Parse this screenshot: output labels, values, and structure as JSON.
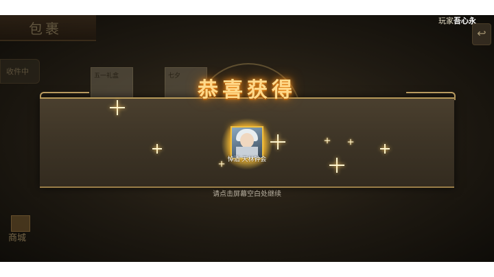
{
  "background": {
    "title": "包裹",
    "player_label": "玩家",
    "player_name": "吾心永",
    "side_tab": "收件中",
    "item_cards": [
      "五一礼盒",
      "七夕"
    ],
    "shop_label": "商城"
  },
  "reward": {
    "title": "恭喜获得",
    "item_name": "悼酒·天林钟会",
    "hint": "请点击屏幕空白处继续"
  },
  "colors": {
    "title_glow": "#ffd98a",
    "banner": "#3d3426",
    "border_gold": "#b89a5a"
  }
}
